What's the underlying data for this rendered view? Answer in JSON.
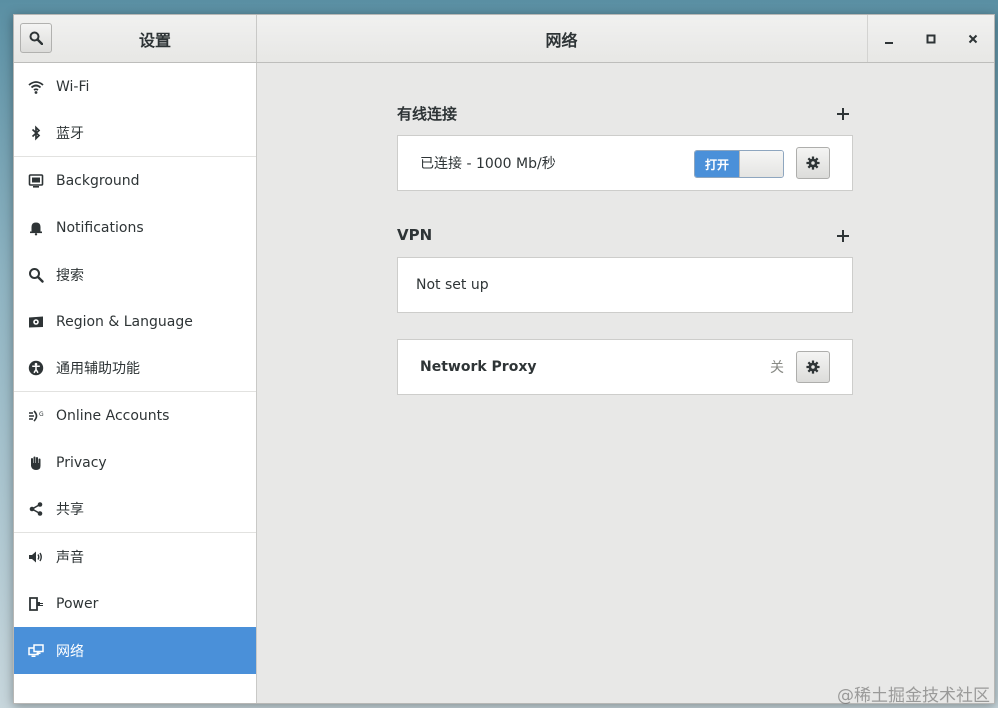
{
  "header": {
    "settings_title": "设置",
    "page_title": "网络",
    "minimize": "–",
    "maximize": "□",
    "close": "×"
  },
  "sidebar": {
    "items": [
      {
        "label": "Wi-Fi",
        "icon": "wifi-icon"
      },
      {
        "label": "蓝牙",
        "icon": "bluetooth-icon"
      },
      {
        "label": "Background",
        "icon": "background-icon"
      },
      {
        "label": "Notifications",
        "icon": "bell-icon"
      },
      {
        "label": "搜索",
        "icon": "search-icon"
      },
      {
        "label": "Region & Language",
        "icon": "region-icon"
      },
      {
        "label": "通用辅助功能",
        "icon": "accessibility-icon"
      },
      {
        "label": "Online Accounts",
        "icon": "online-accounts-icon"
      },
      {
        "label": "Privacy",
        "icon": "hand-icon"
      },
      {
        "label": "共享",
        "icon": "share-icon"
      },
      {
        "label": "声音",
        "icon": "speaker-icon"
      },
      {
        "label": "Power",
        "icon": "power-icon"
      },
      {
        "label": "网络",
        "icon": "network-icon",
        "active": true
      }
    ]
  },
  "wired": {
    "title": "有线连接",
    "status": "已连接 - 1000 Mb/秒",
    "switch_label": "打开",
    "switch_on": true
  },
  "vpn": {
    "title": "VPN",
    "status": "Not set up"
  },
  "proxy": {
    "title": "Network Proxy",
    "status": "关"
  },
  "watermark": "@稀土掘金技术社区",
  "colors": {
    "accent": "#4a90d9",
    "window_bg": "#e8e8e7",
    "text": "#2e3436"
  }
}
